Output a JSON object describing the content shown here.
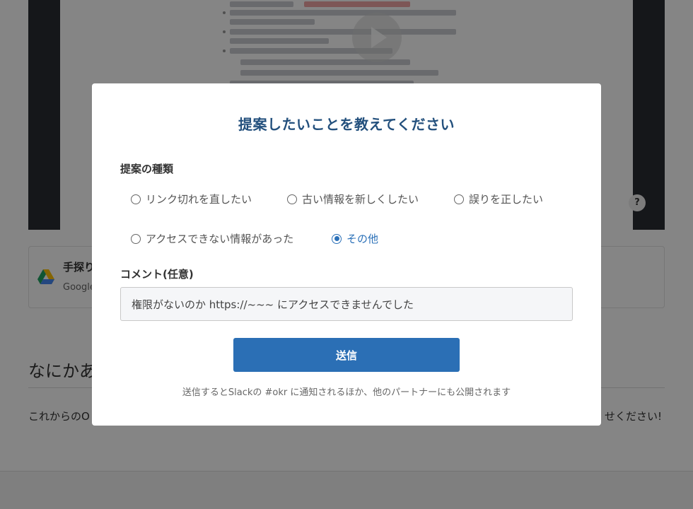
{
  "background": {
    "file_card": {
      "title": "手探り",
      "subtitle": "Google"
    },
    "section": {
      "heading": "なにかあ",
      "text_left": "これからのO",
      "text_right": "せください!"
    },
    "help_symbol": "?"
  },
  "modal": {
    "title": "提案したいことを教えてください",
    "type_label": "提案の種類",
    "options": [
      {
        "label": "リンク切れを直したい",
        "selected": false
      },
      {
        "label": "古い情報を新しくしたい",
        "selected": false
      },
      {
        "label": "誤りを正したい",
        "selected": false
      },
      {
        "label": "アクセスできない情報があった",
        "selected": false
      },
      {
        "label": "その他",
        "selected": true
      }
    ],
    "comment_label": "コメント(任意)",
    "comment_value": "権限がないのか https://~~~ にアクセスできませんでした",
    "submit_label": "送信",
    "notice": "送信するとSlackの #okr に通知されるほか、他のパートナーにも公開されます"
  },
  "colors": {
    "title": "#23507d",
    "accent": "#2b6fb5",
    "overlay": "rgba(0,0,0,0.48)"
  }
}
